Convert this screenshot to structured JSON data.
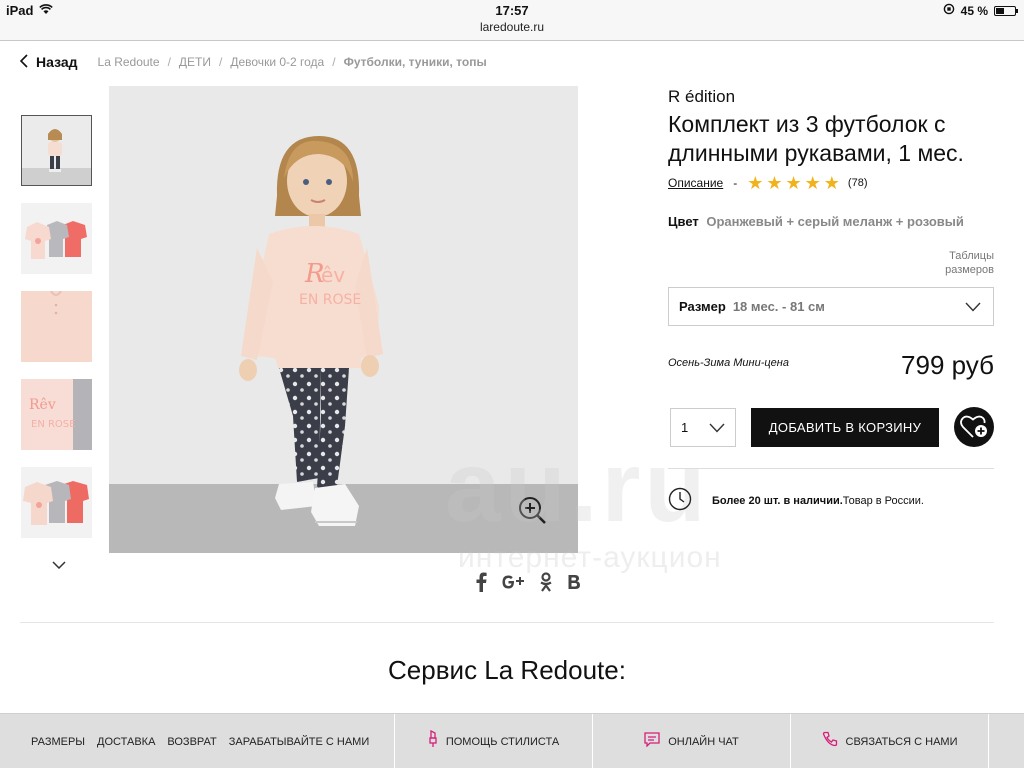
{
  "status_bar": {
    "device": "iPad",
    "time": "17:57",
    "url": "laredoute.ru",
    "battery": "45 %",
    "battery_level": 0.45
  },
  "breadcrumb": {
    "back_label": "Назад",
    "items": [
      "La Redoute",
      "ДЕТИ",
      "Девочки 0-2 года"
    ],
    "current": "Футболки, туники, топы",
    "separator": "/"
  },
  "product": {
    "brand": "R édition",
    "title": "Комплект из 3 футболок с длинными рукавами, 1 мес.",
    "description_link": "Описание",
    "dash": "-",
    "rating_stars": 5,
    "rating_count": "(78)",
    "color_label": "Цвет",
    "color_value": "Оранжевый + серый меланж + розовый",
    "size_table_label": "Таблицы размеров",
    "size_label": "Размер",
    "size_value": "18 мес. - 81 см",
    "price_label": "Осень-Зима Мини-цена",
    "price": "799 руб",
    "quantity": "1",
    "add_to_cart": "ДОБАВИТЬ В КОРЗИНУ",
    "stock_bold": "Более 20 шт. в наличии.",
    "stock_text": "Товар в России."
  },
  "watermark": {
    "main": "au.ru",
    "sub": "интернет-аукцион"
  },
  "service": {
    "title": "Сервис La Redoute:"
  },
  "bottom_bar": {
    "links": [
      "РАЗМЕРЫ",
      "ДОСТАВКА",
      "ВОЗВРАТ",
      "ЗАРАБАТЫВАЙТЕ С НАМИ"
    ],
    "stylist": "ПОМОЩЬ СТИЛИСТА",
    "chat": "ОНЛАЙН ЧАТ",
    "contact": "СВЯЗАТЬСЯ С НАМИ"
  },
  "colors": {
    "accent_pink": "#d61e7a",
    "star": "#f2b21b",
    "button": "#111111"
  },
  "icons": [
    "wifi-icon",
    "lock-rotation-icon",
    "chevron-left-icon",
    "chevron-down-icon",
    "zoom-icon",
    "facebook-icon",
    "google-plus-icon",
    "odnoklassniki-icon",
    "vkontakte-icon",
    "heart-plus-icon",
    "clock-icon",
    "lipstick-icon",
    "chat-icon",
    "phone-icon"
  ]
}
